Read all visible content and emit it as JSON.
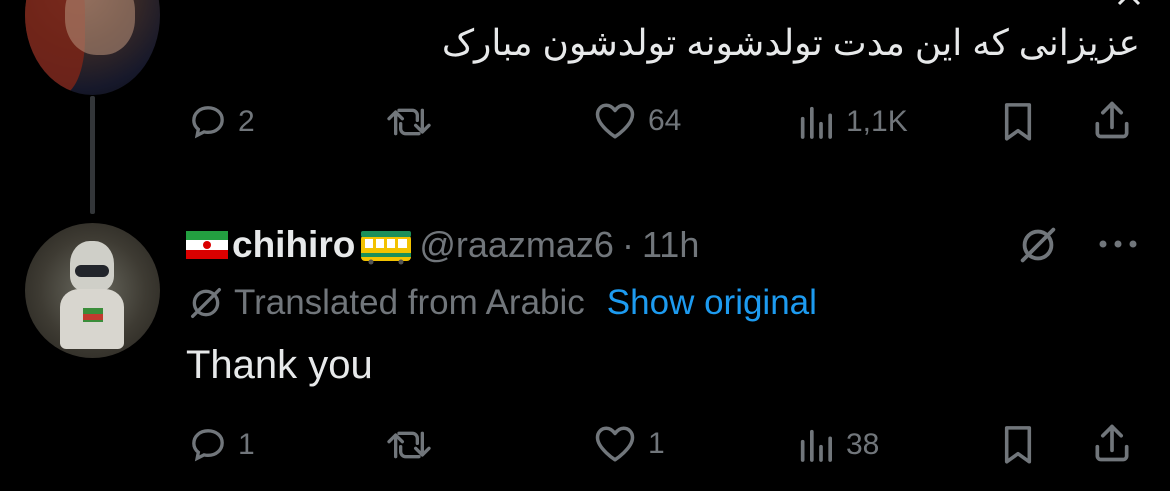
{
  "tweet1": {
    "text": "عزیزانی که این مدت تولدشونه تولدشون مبارک",
    "actions": {
      "replies": "2",
      "retweets": "",
      "likes": "64",
      "views": "1,1K"
    }
  },
  "tweet2": {
    "flag_emoji": "🇮🇷",
    "display_name": "chihiro",
    "train_emoji": "🚃",
    "handle": "@raazmaz6",
    "separator": "·",
    "time": "11h",
    "translated_label": "Translated from Arabic",
    "show_original": "Show original",
    "text": "Thank you",
    "actions": {
      "replies": "1",
      "retweets": "",
      "likes": "1",
      "views": "38"
    }
  },
  "colors": {
    "background": "#000000",
    "text": "#e7e9ea",
    "muted": "#71767b",
    "link": "#1d9bf0"
  },
  "icons": [
    "reply-icon",
    "retweet-icon",
    "like-icon",
    "views-icon",
    "bookmark-icon",
    "share-icon",
    "grok-icon",
    "more-icon",
    "translate-icon",
    "close-icon"
  ]
}
